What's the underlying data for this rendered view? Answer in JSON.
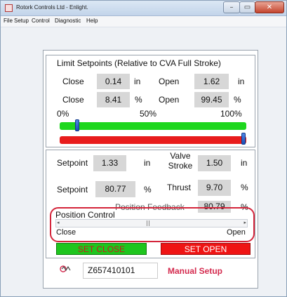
{
  "window": {
    "title": "Rotork Controls Ltd - Enlight.",
    "min_glyph": "–",
    "max_glyph": "▭",
    "close_glyph": "✕"
  },
  "menu": [
    "File",
    "Setup",
    "Control",
    "Diagnostic",
    "Help"
  ],
  "limits": {
    "heading": "Limit Setpoints (Relative to CVA Full Stroke)",
    "close_label": "Close",
    "open_label": "Open",
    "close_in": "0.14",
    "open_in": "1.62",
    "unit_in": "in",
    "close_pct": "8.41",
    "open_pct": "99.45",
    "unit_pct": "%",
    "scale": [
      "0%",
      "50%",
      "100%"
    ],
    "green_slider_fraction": 0.0841,
    "red_slider_fraction": 0.9945,
    "green_color": "#1ed71e",
    "red_color": "#e81c1c"
  },
  "status": {
    "setpoint_label": "Setpoint",
    "setpoint_in": "1.33",
    "unit_in": "in",
    "valve_stroke_line1": "Valve",
    "valve_stroke_line2": "Stroke",
    "valve_stroke_in": "1.50",
    "setpoint_pct": "80.77",
    "unit_pct": "%",
    "thrust_label": "Thrust",
    "thrust_pct": "9.70",
    "position_feedback_label": "Position Feedback",
    "position_feedback_value": "80.79",
    "position_feedback_unit": "%"
  },
  "position_control": {
    "label": "Position Control",
    "close_label": "Close",
    "open_label": "Open",
    "slider_value_fraction": 0.47,
    "highlight_color": "#d4253b"
  },
  "buttons": {
    "set_close": "SET CLOSE",
    "set_open": "SET OPEN"
  },
  "footer": {
    "serial": "Z657410101",
    "mode": "Manual Setup",
    "logo_icon": "rotork-logo-icon"
  }
}
